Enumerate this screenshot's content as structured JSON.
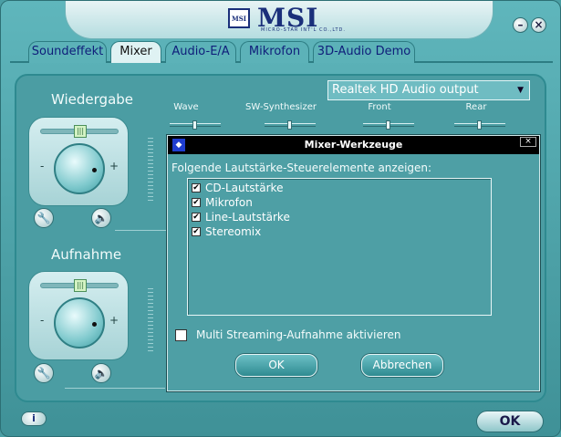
{
  "brand": {
    "logo_badge": "MSI",
    "logo_text": "MSI",
    "logo_subtext": "MICRO-STAR INT'L CO.,LTD."
  },
  "window": {
    "minimize_symbol": "–",
    "close_symbol": "×"
  },
  "tabs": [
    {
      "label": "Soundeffekt",
      "active": false
    },
    {
      "label": "Mixer",
      "active": true
    },
    {
      "label": "Audio-E/A",
      "active": false
    },
    {
      "label": "Mikrofon",
      "active": false
    },
    {
      "label": "3D-Audio Demo",
      "active": false
    }
  ],
  "playback": {
    "title": "Wiedergabe",
    "minus": "-",
    "plus": "+"
  },
  "record": {
    "title": "Aufnahme",
    "minus": "-",
    "plus": "+"
  },
  "device_select": {
    "value": "Realtek HD Audio output"
  },
  "channels": [
    {
      "label": "Wave",
      "level": 0.5
    },
    {
      "label": "SW-Synthesizer",
      "level": 0.5
    },
    {
      "label": "Front",
      "level": 0.5
    },
    {
      "label": "Rear",
      "level": 0.5
    }
  ],
  "footer": {
    "info_symbol": "i",
    "ok_label": "OK"
  },
  "dialog": {
    "title": "Mixer-Werkzeuge",
    "close_symbol": "×",
    "instruction": "Folgende Lautstärke-Steuerelemente anzeigen:",
    "items": [
      {
        "label": "CD-Lautstärke",
        "checked": true
      },
      {
        "label": "Mikrofon",
        "checked": true
      },
      {
        "label": "Line-Lautstärke",
        "checked": true
      },
      {
        "label": "Stereomix",
        "checked": true
      }
    ],
    "check_mark": "✔",
    "multi_streaming": {
      "label": "Multi Streaming-Aufnahme aktivieren",
      "checked": false
    },
    "ok_label": "OK",
    "cancel_label": "Abbrechen"
  },
  "colors": {
    "background": "#4b9da3",
    "brand_blue": "#1a2f7a",
    "dialog_titlebar": "#000000"
  }
}
